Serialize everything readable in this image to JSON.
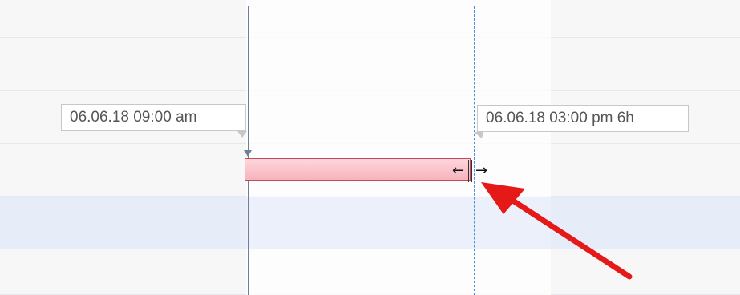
{
  "timeline": {
    "start_tooltip": "06.06.18 09:00 am",
    "end_tooltip": "06.06.18 03:00 pm 6h"
  },
  "task": {
    "name": "",
    "state": "resizing"
  },
  "icons": {
    "resize_cursor": "resize-horizontal-icon",
    "annotation_arrow": "red-pointer-arrow-icon"
  },
  "colors": {
    "task_fill": "#f6b3bd",
    "task_border": "#c44a5a",
    "selected_row": "#e6ecf8",
    "guide_line": "#4a90d9",
    "arrow": "#e61919"
  }
}
